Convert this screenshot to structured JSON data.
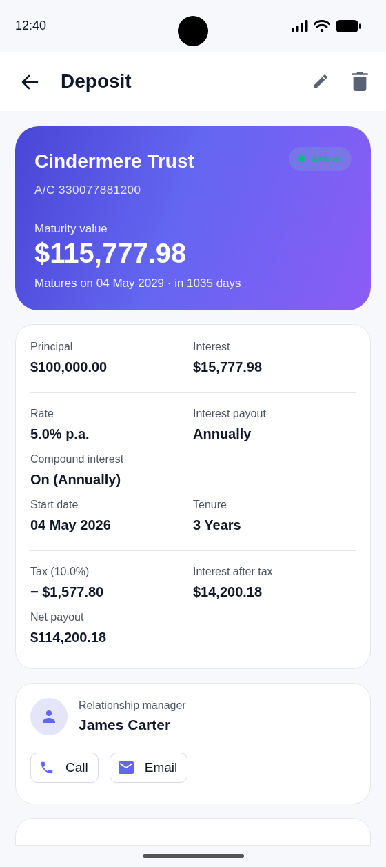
{
  "status_bar": {
    "time": "12:40"
  },
  "header": {
    "title": "Deposit"
  },
  "hero": {
    "name": "Cindermere Trust",
    "account": "A/C 330077881200",
    "status": "Active",
    "maturity_label": "Maturity value",
    "maturity_value": "$115,777.98",
    "maturity_note": "Matures on 04 May 2029 · in 1035 days"
  },
  "details": [
    [
      [
        {
          "label": "Principal",
          "value": "$100,000.00"
        },
        {
          "label": "Interest",
          "value": "$15,777.98"
        }
      ]
    ],
    [
      [
        {
          "label": "Rate",
          "value": "5.0% p.a."
        },
        {
          "label": "Interest payout",
          "value": "Annually"
        }
      ],
      [
        {
          "label": "Compound interest",
          "value": "On (Annually)"
        }
      ],
      [
        {
          "label": "Start date",
          "value": "04 May 2026"
        },
        {
          "label": "Tenure",
          "value": "3 Years"
        }
      ]
    ],
    [
      [
        {
          "label": "Tax (10.0%)",
          "value": "− $1,577.80"
        },
        {
          "label": "Interest after tax",
          "value": "$14,200.18"
        }
      ],
      [
        {
          "label": "Net payout",
          "value": "$114,200.18"
        }
      ]
    ]
  ],
  "manager": {
    "role": "Relationship manager",
    "name": "James Carter",
    "actions": [
      {
        "kind": "call",
        "label": "Call"
      },
      {
        "kind": "email",
        "label": "Email"
      }
    ]
  }
}
